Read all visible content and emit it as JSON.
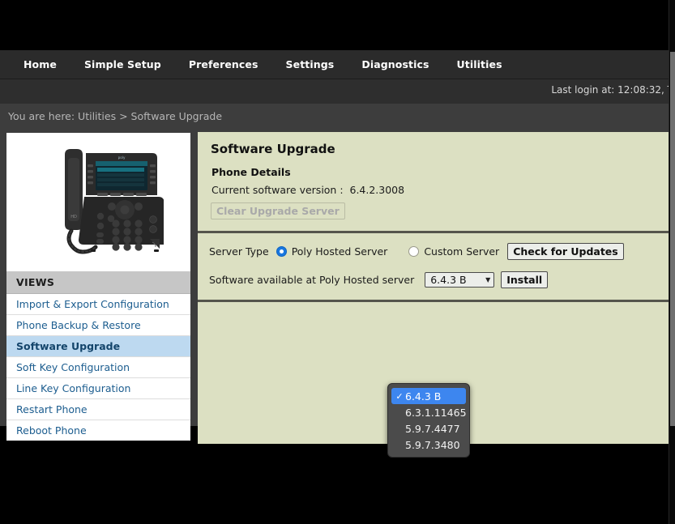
{
  "nav": {
    "items": [
      {
        "label": "Home"
      },
      {
        "label": "Simple Setup"
      },
      {
        "label": "Preferences"
      },
      {
        "label": "Settings"
      },
      {
        "label": "Diagnostics"
      },
      {
        "label": "Utilities"
      }
    ]
  },
  "session": {
    "last_login": "Last login at: 12:08:32, T"
  },
  "breadcrumb": {
    "text": "You are here: Utilities > Software Upgrade"
  },
  "sidebar": {
    "header": "VIEWS",
    "items": [
      {
        "label": "Import & Export Configuration",
        "active": false
      },
      {
        "label": "Phone Backup & Restore",
        "active": false
      },
      {
        "label": "Software Upgrade",
        "active": true
      },
      {
        "label": "Soft Key Configuration",
        "active": false
      },
      {
        "label": "Line Key Configuration",
        "active": false
      },
      {
        "label": "Restart Phone",
        "active": false
      },
      {
        "label": "Reboot Phone",
        "active": false
      }
    ],
    "phone_image_alt": "poly-vvx-desk-phone"
  },
  "main": {
    "page_title": "Software Upgrade",
    "phone_details": {
      "section_title": "Phone Details",
      "current_version_label": "Current software version :",
      "current_version_value": "6.4.2.3008",
      "clear_upgrade_server_label": "Clear Upgrade Server"
    },
    "server": {
      "server_type_label": "Server Type",
      "poly_hosted_label": "Poly Hosted Server",
      "custom_server_label": "Custom Server",
      "check_for_updates_label": "Check for Updates",
      "software_available_label": "Software available at Poly Hosted server",
      "install_label": "Install",
      "selected_version": "6.4.3 B"
    },
    "version_dropdown": {
      "open": true,
      "options": [
        {
          "label": "6.4.3 B",
          "selected": true
        },
        {
          "label": "6.3.1.11465",
          "selected": false
        },
        {
          "label": "5.9.7.4477",
          "selected": false
        },
        {
          "label": "5.9.7.3480",
          "selected": false
        }
      ]
    }
  },
  "colors": {
    "nav_bg": "#2b2b2b",
    "breadcrumb_bg": "#3d3d3d",
    "panel_bg": "#dce0c2",
    "accent_blue": "#1877e0",
    "selection_blue": "#3d86ef",
    "link_blue": "#1c5d8f",
    "sidebar_active_bg": "#bdd9f0"
  }
}
